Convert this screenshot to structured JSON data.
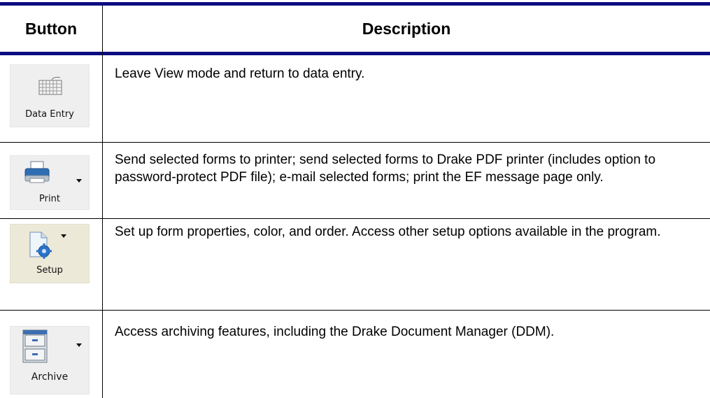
{
  "table": {
    "headers": [
      "Button",
      "Description"
    ],
    "rows": [
      {
        "button_label": "Data Entry",
        "icon": "keyboard-icon",
        "has_dropdown": false,
        "description": "Leave View mode and return to data entry."
      },
      {
        "button_label": "Print",
        "icon": "printer-icon",
        "has_dropdown": true,
        "description": "Send selected forms to printer; send selected forms to Drake PDF printer (includes option to password-protect PDF file); e-mail selected forms; print the EF message page only."
      },
      {
        "button_label": "Setup",
        "icon": "setup-document-gear-icon",
        "has_dropdown": true,
        "description": "Set up form properties, color, and order. Access other setup options available in the program."
      },
      {
        "button_label": "Archive",
        "icon": "file-cabinet-icon",
        "has_dropdown": true,
        "description": "Access archiving features, including the Drake Document Manager (DDM)."
      }
    ]
  },
  "colors": {
    "rule": "#0b0b80",
    "button_bg": "#efefef",
    "setup_bg": "#ece9d8"
  }
}
